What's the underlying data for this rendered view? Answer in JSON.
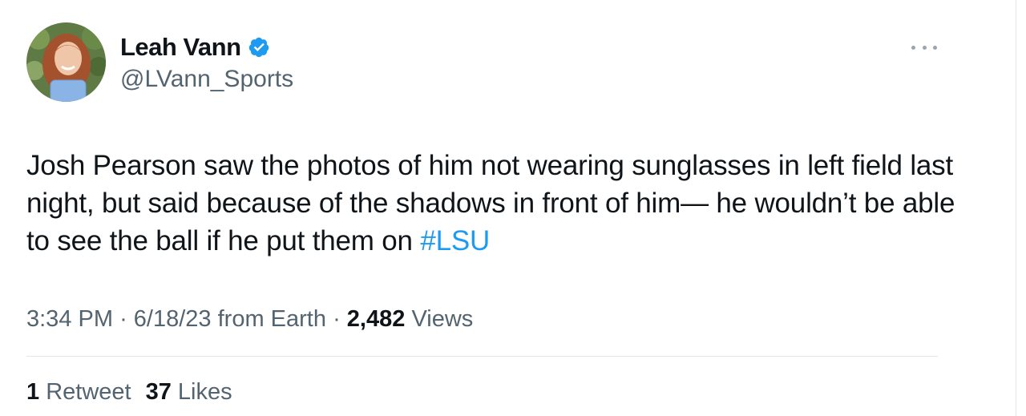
{
  "author": {
    "display_name": "Leah Vann",
    "handle": "@LVann_Sports",
    "verified": true,
    "verified_color": "#1d9bf0"
  },
  "tweet": {
    "text_before_hashtag": "Josh Pearson saw the photos of him not wearing sunglasses in left field last night, but said because of the shadows in front of him— he wouldn’t be able to see the ball if he put them on ",
    "hashtag": "#LSU",
    "time": "3:34 PM",
    "separator": "·",
    "date": "6/18/23",
    "source": "from Earth",
    "views_count": "2,482",
    "views_label": "Views"
  },
  "stats": {
    "retweets_count": "1",
    "retweets_label": "Retweet",
    "likes_count": "37",
    "likes_label": "Likes"
  },
  "icons": {
    "more": "more-options-icon",
    "verified": "verified-badge-icon"
  },
  "colors": {
    "text": "#0f1419",
    "secondary": "#536471",
    "link": "#1d9bf0"
  }
}
